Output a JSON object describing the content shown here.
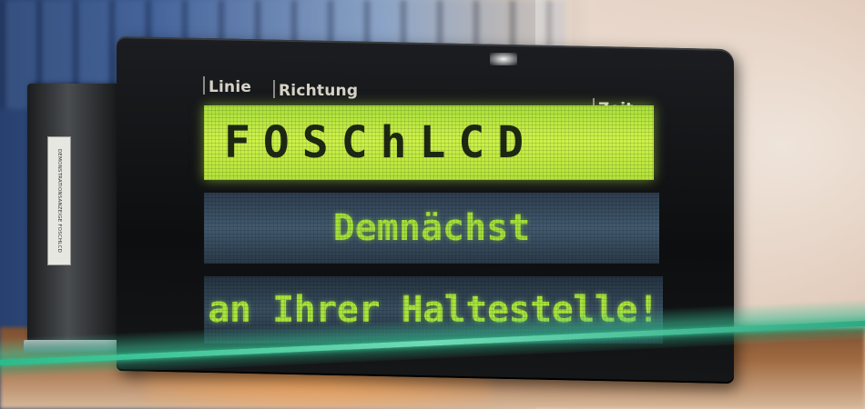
{
  "bracket_label": "DEMONSTRATIONSANZEIGE FOSCHLCD",
  "panel": {
    "header_line": "Linie",
    "header_direction": "Richtung",
    "header_time": "Zeit"
  },
  "lcd": {
    "row1": "FOSChLCD",
    "row2": "Demnächst",
    "row3": "an Ihrer Haltestelle!"
  },
  "colors": {
    "lcd_backlight": "#cdf24a",
    "lcd_text_green": "#a4e03a",
    "housing": "#111214",
    "glass_edge": "#3fc89a"
  }
}
